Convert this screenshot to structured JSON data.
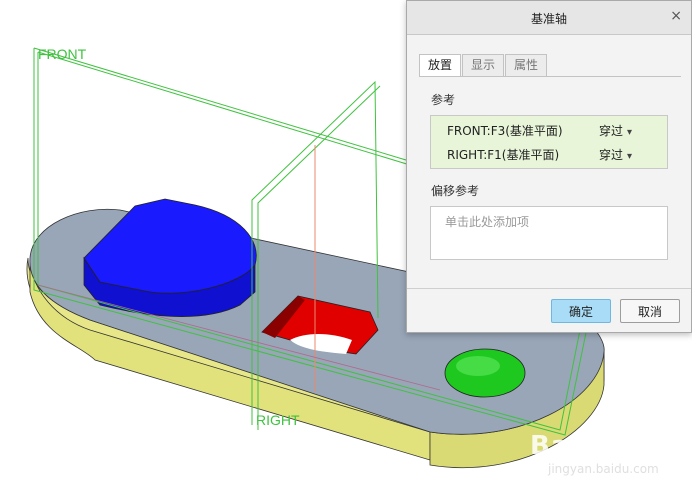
{
  "viewport": {
    "plane_labels": {
      "front": "FRONT",
      "right": "RIGHT"
    }
  },
  "colors": {
    "top_face": "#98a6b8",
    "side_face": "#e7e78a",
    "boss": "#1a1aff",
    "hole_red": "#e00000",
    "green_feature": "#1ec81e",
    "plane_green": "#3fc23f",
    "dialog_bg": "#f3f3f3",
    "ok_button": "#a8dcf7",
    "ref_list_bg": "#e8f5d9"
  },
  "dialog": {
    "title": "基准轴",
    "close_icon": "×",
    "tabs": [
      {
        "label": "放置",
        "active": true
      },
      {
        "label": "显示",
        "active": false
      },
      {
        "label": "属性",
        "active": false
      }
    ],
    "references": {
      "label": "参考",
      "items": [
        {
          "name": "FRONT:F3(基准平面)",
          "type": "穿过"
        },
        {
          "name": "RIGHT:F1(基准平面)",
          "type": "穿过"
        }
      ]
    },
    "offset": {
      "label": "偏移参考",
      "placeholder": "单击此处添加项"
    },
    "buttons": {
      "ok": "确定",
      "cancel": "取消"
    }
  },
  "watermark": {
    "logo": "Bai经验",
    "url": "jingyan.baidu.com"
  }
}
